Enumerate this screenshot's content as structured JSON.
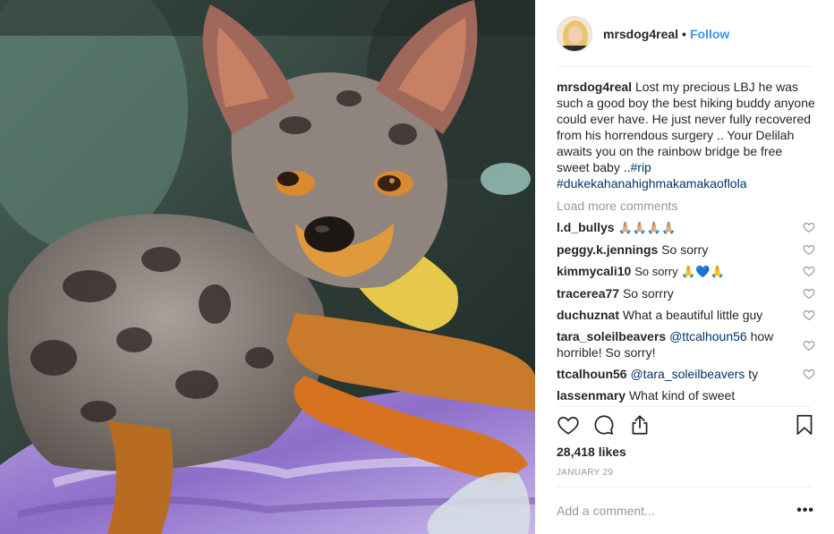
{
  "header": {
    "username": "mrsdog4real",
    "separator": "•",
    "follow_label": "Follow"
  },
  "caption": {
    "username": "mrsdog4real",
    "text": "Lost my precious LBJ he was such a good boy the best hiking buddy anyone could ever have. He just never fully recovered from his horrendous surgery .. Your Delilah awaits you on the rainbow bridge be free sweet baby ..",
    "hashtag1": "#rip",
    "hashtag2": "#dukekahanahighmakamakaoflola"
  },
  "load_more_label": "Load more comments",
  "comments": [
    {
      "username": "l.d_bullys",
      "text": "🙏🏼🙏🏼🙏🏼🙏🏼"
    },
    {
      "username": "peggy.k.jennings",
      "text": "So sorry"
    },
    {
      "username": "kimmycali10",
      "text": "So sorry 🙏💙🙏"
    },
    {
      "username": "tracerea77",
      "text": "So sorrry"
    },
    {
      "username": "duchuznat",
      "text": "What a beautiful little guy"
    },
    {
      "username": "tara_soleilbeavers",
      "mention": "@ttcalhoun56",
      "text": "how horrible! So sorry!"
    },
    {
      "username": "ttcalhoun56",
      "mention": "@tara_soleilbeavers",
      "text": "ty"
    },
    {
      "username": "lassenmary",
      "text": "What kind of sweet"
    }
  ],
  "likes_label": "28,418 likes",
  "date_label": "JANUARY 29",
  "add_comment_placeholder": "Add a comment...",
  "more_label": "•••",
  "icons": {
    "like": "heart-icon",
    "comment": "comment-bubble-icon",
    "share": "share-icon",
    "save": "bookmark-icon",
    "comment_like": "heart-icon"
  },
  "colors": {
    "link": "#3897f0",
    "hashtag": "#003569",
    "muted": "#999999",
    "text": "#262626"
  }
}
